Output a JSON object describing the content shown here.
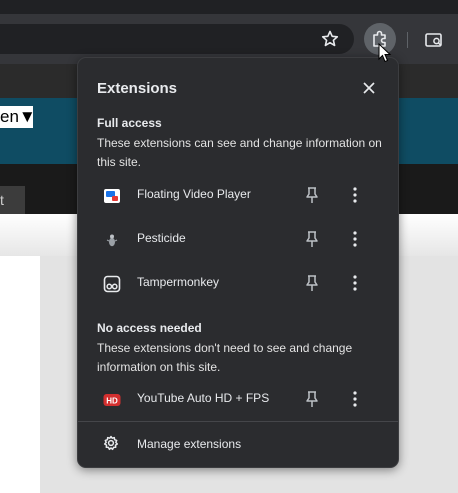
{
  "popup": {
    "title": "Extensions",
    "full_access": {
      "heading": "Full access",
      "description": "These extensions can see and change information on this site.",
      "items": [
        {
          "name": "Floating Video Player",
          "icon": "floating-video-player-icon"
        },
        {
          "name": "Pesticide",
          "icon": "pesticide-icon"
        },
        {
          "name": "Tampermonkey",
          "icon": "tampermonkey-icon"
        }
      ]
    },
    "no_access": {
      "heading": "No access needed",
      "description": "These extensions don't need to see and change information on this site.",
      "items": [
        {
          "name": "YouTube Auto HD + FPS",
          "icon": "youtube-auto-hd-icon",
          "badge": "HD"
        }
      ]
    },
    "manage_label": "Manage extensions"
  },
  "page_behind": {
    "select_text": "en▼",
    "button_text": "t"
  },
  "colors": {
    "popup_bg": "#2b2c2f",
    "toolbar_bg": "#35363a",
    "page_teal": "#0f4c63",
    "hd_red": "#d32f2f"
  }
}
